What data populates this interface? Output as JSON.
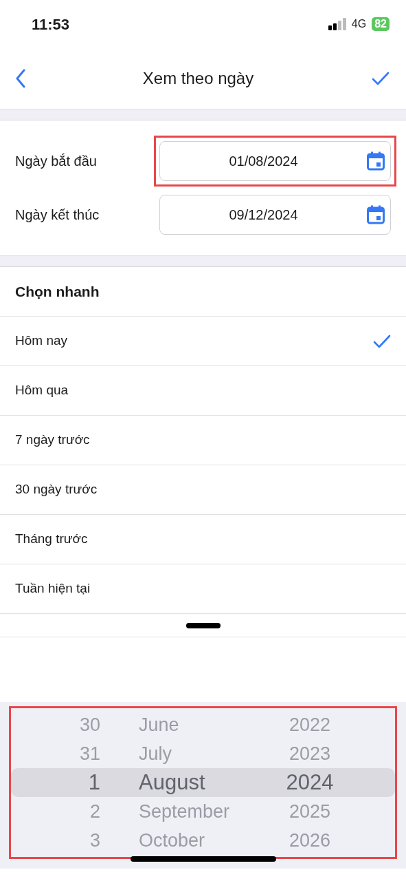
{
  "status_bar": {
    "time": "11:53",
    "network": "4G",
    "battery": "82"
  },
  "nav": {
    "title": "Xem theo ngày"
  },
  "date_fields": [
    {
      "label": "Ngày bắt đầu",
      "value": "01/08/2024",
      "highlighted": true
    },
    {
      "label": "Ngày kết thúc",
      "value": "09/12/2024",
      "highlighted": false
    }
  ],
  "quick_pick": {
    "heading": "Chọn nhanh",
    "items": [
      {
        "label": "Hôm nay",
        "selected": true
      },
      {
        "label": "Hôm qua",
        "selected": false
      },
      {
        "label": "7 ngày trước",
        "selected": false
      },
      {
        "label": "30 ngày trước",
        "selected": false
      },
      {
        "label": "Tháng trước",
        "selected": false
      },
      {
        "label": "Tuần hiện tại",
        "selected": false
      }
    ]
  },
  "picker": {
    "highlighted": true,
    "rows": [
      {
        "day": "30",
        "month": "June",
        "year": "2022",
        "selected": false
      },
      {
        "day": "31",
        "month": "July",
        "year": "2023",
        "selected": false
      },
      {
        "day": "1",
        "month": "August",
        "year": "2024",
        "selected": true
      },
      {
        "day": "2",
        "month": "September",
        "year": "2025",
        "selected": false
      },
      {
        "day": "3",
        "month": "October",
        "year": "2026",
        "selected": false
      }
    ]
  }
}
